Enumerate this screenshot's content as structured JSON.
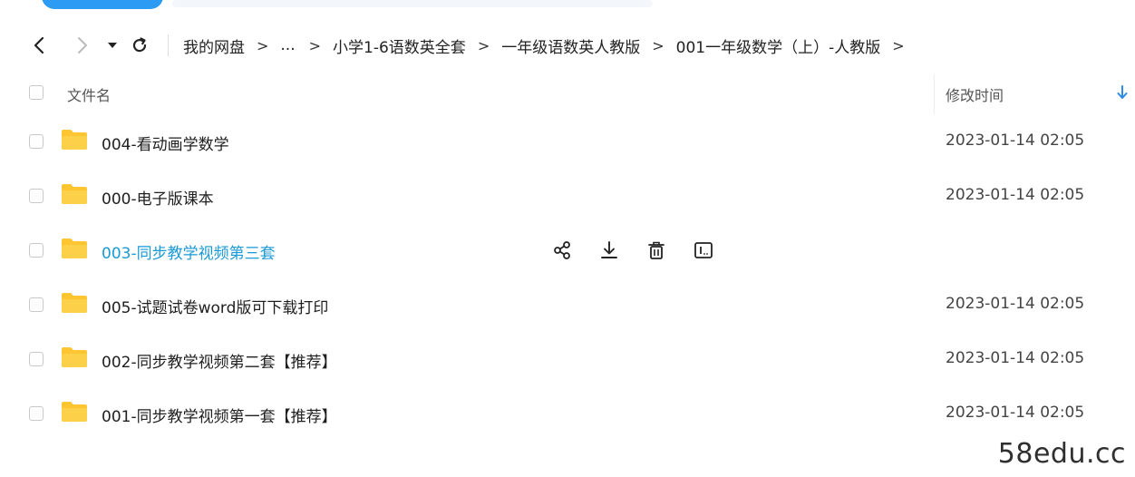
{
  "breadcrumb": {
    "items": [
      "我的网盘",
      "...",
      "小学1-6语数英全套",
      "一年级语数英人教版",
      "001一年级数学（上）-人教版"
    ],
    "separator": ">"
  },
  "header": {
    "name_label": "文件名",
    "mtime_label": "修改时间"
  },
  "files": [
    {
      "name": "004-看动画学数学",
      "time": "2023-01-14 02:05"
    },
    {
      "name": "000-电子版课本",
      "time": "2023-01-14 02:05"
    },
    {
      "name": "003-同步教学视频第三套",
      "time": ""
    },
    {
      "name": "005-试题试卷word版可下载打印",
      "time": "2023-01-14 02:05"
    },
    {
      "name": "002-同步教学视频第二套【推荐】",
      "time": "2023-01-14 02:05"
    },
    {
      "name": "001-同步教学视频第一套【推荐】",
      "time": "2023-01-14 02:05"
    }
  ],
  "icons": {
    "folder": "folder-icon",
    "share": "share-icon",
    "download": "download-icon",
    "delete": "trash-icon",
    "rename": "rename-icon"
  },
  "colors": {
    "accent": "#1a9ad6",
    "folder": "#fcc531",
    "sort_arrow": "#2b8be6"
  },
  "watermark": "58edu.cc"
}
